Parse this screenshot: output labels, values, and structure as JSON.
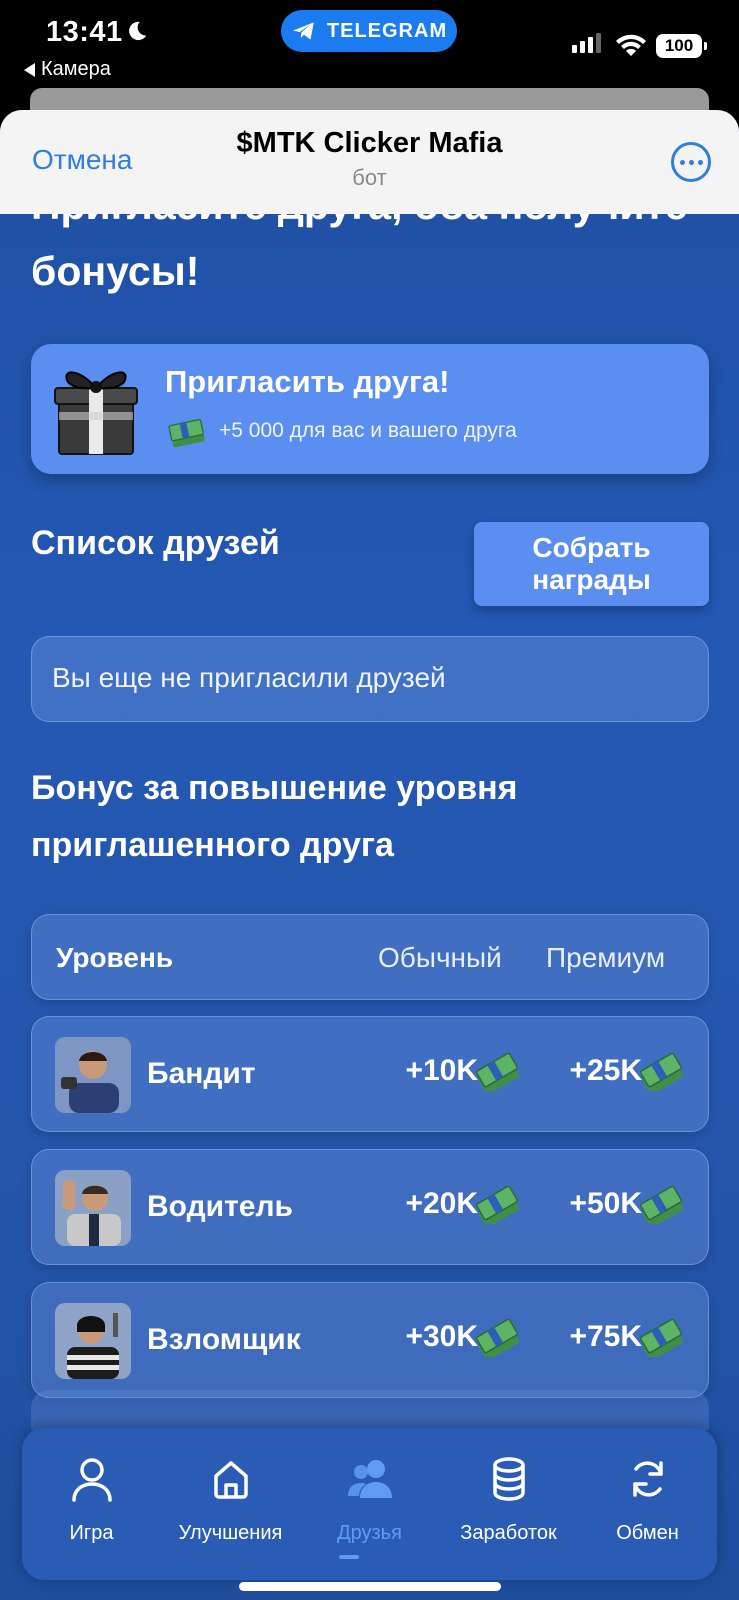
{
  "status_bar": {
    "time": "13:41",
    "telegram_label": "TELEGRAM",
    "back_app": "Камера",
    "battery": "100"
  },
  "tg_header": {
    "cancel_label": "Отмена",
    "title": "$MTK Clicker Mafia",
    "subtitle": "бот"
  },
  "headline": "Пригласите друга, оба получите бонусы!",
  "invite_card": {
    "title": "Пригласить друга!",
    "subtitle": "+5 000 для вас и вашего друга"
  },
  "friends": {
    "title": "Список друзей",
    "collect_label": "Собрать награды",
    "empty_text": "Вы еще не пригласили друзей"
  },
  "bonus": {
    "title": "Бонус за повышение уровня приглашенного друга",
    "header": {
      "level": "Уровень",
      "normal": "Обычный",
      "premium": "Премиум"
    },
    "rows": [
      {
        "name": "Бандит",
        "normal": "+10K",
        "premium": "+25K",
        "avatar_icon": "bandit-avatar"
      },
      {
        "name": "Водитель",
        "normal": "+20K",
        "premium": "+50K",
        "avatar_icon": "driver-avatar"
      },
      {
        "name": "Взломщик",
        "normal": "+30K",
        "premium": "+75K",
        "avatar_icon": "burglar-avatar"
      }
    ]
  },
  "nav": {
    "items": [
      {
        "label": "Игра",
        "icon": "user-icon"
      },
      {
        "label": "Улучшения",
        "icon": "home-icon"
      },
      {
        "label": "Друзья",
        "icon": "friends-icon",
        "active": true
      },
      {
        "label": "Заработок",
        "icon": "database-icon"
      },
      {
        "label": "Обмен",
        "icon": "exchange-icon"
      }
    ]
  },
  "colors": {
    "accent": "#5f9bf5",
    "card": "#5a8ef0",
    "background": "#2358b4",
    "telegram_blue": "#2f7de1"
  }
}
